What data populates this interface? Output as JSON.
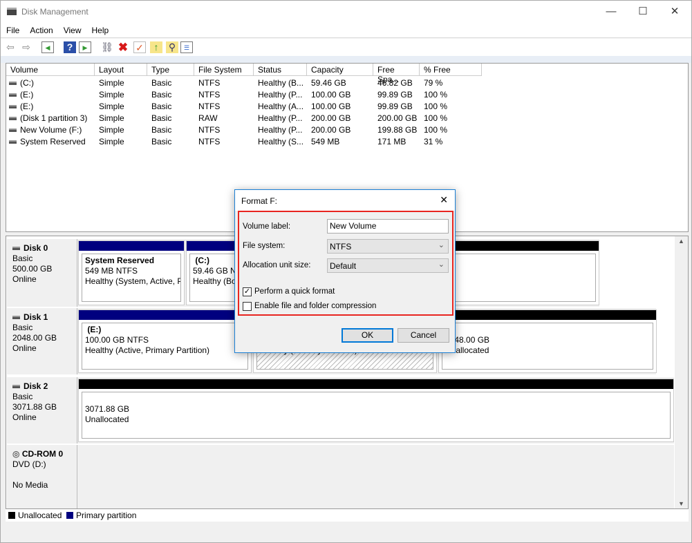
{
  "window": {
    "title": "Disk Management",
    "controls": {
      "minimize": "—",
      "maximize": "☐",
      "close": "✕"
    }
  },
  "menu": [
    "File",
    "Action",
    "View",
    "Help"
  ],
  "toolbar": {
    "icons": [
      "back-icon",
      "forward-icon",
      "console-tree-icon",
      "help-icon",
      "action-pane-icon",
      "connect-disk-icon",
      "delete-icon",
      "properties-icon",
      "import-icon",
      "search-icon",
      "settings-list-icon"
    ]
  },
  "volume_list": {
    "columns": [
      "Volume",
      "Layout",
      "Type",
      "File System",
      "Status",
      "Capacity",
      "Free Spa...",
      "% Free"
    ],
    "rows": [
      [
        "(C:)",
        "Simple",
        "Basic",
        "NTFS",
        "Healthy (B...",
        "59.46 GB",
        "46.82 GB",
        "79 %"
      ],
      [
        "(E:)",
        "Simple",
        "Basic",
        "NTFS",
        "Healthy (P...",
        "100.00 GB",
        "99.89 GB",
        "100 %"
      ],
      [
        "(E:)",
        "Simple",
        "Basic",
        "NTFS",
        "Healthy (A...",
        "100.00 GB",
        "99.89 GB",
        "100 %"
      ],
      [
        "(Disk 1 partition 3)",
        "Simple",
        "Basic",
        "RAW",
        "Healthy (P...",
        "200.00 GB",
        "200.00 GB",
        "100 %"
      ],
      [
        "New Volume (F:)",
        "Simple",
        "Basic",
        "NTFS",
        "Healthy (P...",
        "200.00 GB",
        "199.88 GB",
        "100 %"
      ],
      [
        "System Reserved",
        "Simple",
        "Basic",
        "NTFS",
        "Healthy (S...",
        "549 MB",
        "171 MB",
        "31 %"
      ]
    ]
  },
  "disks": [
    {
      "name": "Disk 0",
      "type": "Basic",
      "size": "500.00 GB",
      "state": "Online",
      "partitions": [
        {
          "name": "System Reserved",
          "size": "549 MB NTFS",
          "status": "Healthy (System, Active, Pr"
        },
        {
          "name": "(C:)",
          "size": "59.46 GB NTFS",
          "status": "Healthy (Boot"
        }
      ]
    },
    {
      "name": "Disk 1",
      "type": "Basic",
      "size": "2048.00 GB",
      "state": "Online",
      "partitions": [
        {
          "name": "(E:)",
          "size": "100.00 GB NTFS",
          "status": "Healthy (Active, Primary Partition)"
        },
        {
          "status": "Healthy (Primary Partition)"
        },
        {
          "size": "1548.00 GB",
          "status": "Unallocated"
        }
      ]
    },
    {
      "name": "Disk 2",
      "type": "Basic",
      "size": "3071.88 GB",
      "state": "Online",
      "partitions": [
        {
          "size": "3071.88 GB",
          "status": "Unallocated"
        }
      ]
    },
    {
      "name": "CD-ROM 0",
      "type": "DVD (D:)",
      "state": "No Media"
    }
  ],
  "legend": [
    {
      "label": "Unallocated",
      "color": "#000000"
    },
    {
      "label": "Primary partition",
      "color": "#00007f"
    }
  ],
  "dialog": {
    "title": "Format F:",
    "volume_label": {
      "label": "Volume label:",
      "value": "New Volume"
    },
    "file_system": {
      "label": "File system:",
      "value": "NTFS"
    },
    "allocation": {
      "label": "Allocation unit size:",
      "value": "Default"
    },
    "quick_format": {
      "label": "Perform a quick format",
      "checked": true
    },
    "compression": {
      "label": "Enable file and folder compression",
      "checked": false
    },
    "ok": "OK",
    "cancel": "Cancel",
    "close": "✕",
    "highlight_color": "#e8241f"
  }
}
